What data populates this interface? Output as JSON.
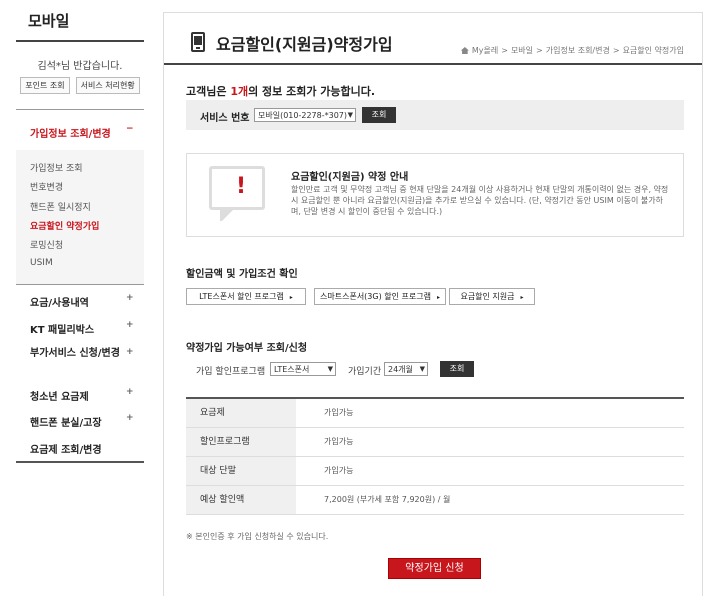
{
  "sidebar": {
    "title": "모바일",
    "greeting": "김석*님 반갑습니다.",
    "point_btn": "포인트 조회",
    "service_btn": "서비스 처리현황",
    "active_menu": "가입정보 조회/변경",
    "active_toggle": "−",
    "sub_items": [
      "가입정보 조회",
      "번호변경",
      "핸드폰 일시정지",
      "요금할인 약정가입",
      "로밍신청",
      "USIM"
    ],
    "menus": [
      "요금/사용내역",
      "KT 패밀리박스",
      "부가서비스 신청/변경",
      "청소년 요금제",
      "핸드폰 분실/고장",
      "요금제 조회/변경"
    ],
    "plus": "+"
  },
  "header": {
    "title": "요금할인(지원금)약정가입",
    "breadcrumb": [
      "My올레",
      ">",
      "모바일",
      ">",
      "가입정보 조회/변경",
      ">",
      "요금할인 약정가입"
    ]
  },
  "info": {
    "prefix": "고객님은 ",
    "count": "1개",
    "suffix": "의 정보 조회가 가능합니다."
  },
  "service": {
    "label": "서비스 번호",
    "selected": "모바일(010-2278-*307)",
    "arrow": "▼",
    "search_btn": "조회"
  },
  "notice": {
    "title": "요금할인(지원금) 약정 안내",
    "body": "할인만료 고객 및 무약정 고객님 중 현재 단말을 24개월 이상 사용하거나 현재 단말의 개통이력이 없는 경우, 약정 시 요금할인 뿐 아니라 요금할인(지원금)을 추가로 받으실 수 있습니다. (단, 약정기간 동안 USIM 이동이 불가하며, 단말 변경 시 할인이 중단됨 수 있습니다.)"
  },
  "discount_section": {
    "title": "할인금액 및 가입조건 확인",
    "buttons": [
      "LTE스폰서 할인 프로그램",
      "스마트스폰서(3G) 할인 프로그램",
      "요금할인 지원금"
    ],
    "arrow": "▸"
  },
  "eligibility": {
    "title": "약정가입 가능여부 조회/신청",
    "program_label": "가입 할인프로그램",
    "program_value": "LTE스폰서",
    "period_label": "가입기간",
    "period_value": "24개월",
    "search_btn": "조회",
    "rows": [
      {
        "head": "요금제",
        "value": "가입가능"
      },
      {
        "head": "할인프로그램",
        "value": "가입가능"
      },
      {
        "head": "대상 단말",
        "value": "가입가능"
      },
      {
        "head": "예상 할인액",
        "value": "7,200원 (부가세 포함 7,920원) / 월"
      }
    ]
  },
  "footnote": "※ 본인인증 후 가입 신청하실 수 있습니다.",
  "apply_btn": "약정가입 신청"
}
